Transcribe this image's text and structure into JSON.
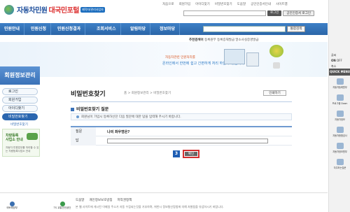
{
  "header": {
    "logo_main": "자동차민원",
    "logo_accent": "대국민포털",
    "logo_badge": "제작자/관리사업자",
    "top_links": [
      "처음으로",
      "회원가입",
      "아이디찾기",
      "비밀번호찾기",
      "도움말",
      "공인인증서인내",
      "사이트맵"
    ],
    "login_label": "로그인",
    "cert_label": "공인인증서 로그인"
  },
  "nav": {
    "items": [
      "민원안내",
      "민원신청",
      "민원신청결과",
      "조회서비스",
      "알림마당",
      "정보마당"
    ],
    "search_button": "통합검색"
  },
  "keywords": {
    "label": "추천검색어",
    "text": "등록원부  등록증재발급  말소사실증명발급"
  },
  "banner": {
    "line1": "자동차관련 민원처리를",
    "line2": "온라인에서 한번에 쉽고 간편하게 처리 하실 수 있습니다."
  },
  "sidebar": {
    "title": "회원정보관리",
    "items": [
      {
        "label": "로그인",
        "active": false
      },
      {
        "label": "회원가입",
        "active": false
      },
      {
        "label": "아이디찾기",
        "active": false
      },
      {
        "label": "비밀번호찾기",
        "active": true
      }
    ],
    "subitem": "비밀번호찾기",
    "promo_title_1": "차량등록",
    "promo_title_2": "사업소 안내",
    "promo_text": "자동차 민원업무를 처리할 수 있는 차량등록사업소 안내"
  },
  "main": {
    "title": "비밀번호찾기",
    "breadcrumb": "홈  >  회원정보관리  >  비밀번호찾기",
    "print_button": "인쇄하기",
    "section_title": "비밀번호찾기 질문",
    "notice": "회원님이 가입시 등록하신던 다음 질문에 대한 답을 입력해 주시기 바랍니다.",
    "form": {
      "question_label": "질문",
      "question_value": "나의 좌우명은?",
      "answer_label": "답",
      "answer_value": ""
    },
    "step_number": "3",
    "confirm_button": "확인"
  },
  "footer": {
    "org1": "국토해양부",
    "org2": "TS 교통안전공단",
    "links": [
      "도움말",
      "개인정보보호방침",
      "저작권정책"
    ],
    "copyright": "본 웹 사이트에 게시된 이메일 주소가 자동 수집되는것을 거부하며, 위반시 정보통신망법에 의해 처벌됨을 유념하시기 바랍니다."
  },
  "quickbar": {
    "font_label": "글씨",
    "on_label": "ON",
    "off_label": "OFF",
    "size_label": "축소",
    "quick_menu": "QUICK MENU",
    "items": [
      "자동차등록원부",
      "프로그램 Down",
      "자동차정보",
      "자동차종합검사",
      "자동차정보원부",
      "자주하는질문"
    ]
  },
  "colors": {
    "brand": "#2c66a8",
    "accent": "#d32f2f",
    "step": "#1e5db3"
  }
}
